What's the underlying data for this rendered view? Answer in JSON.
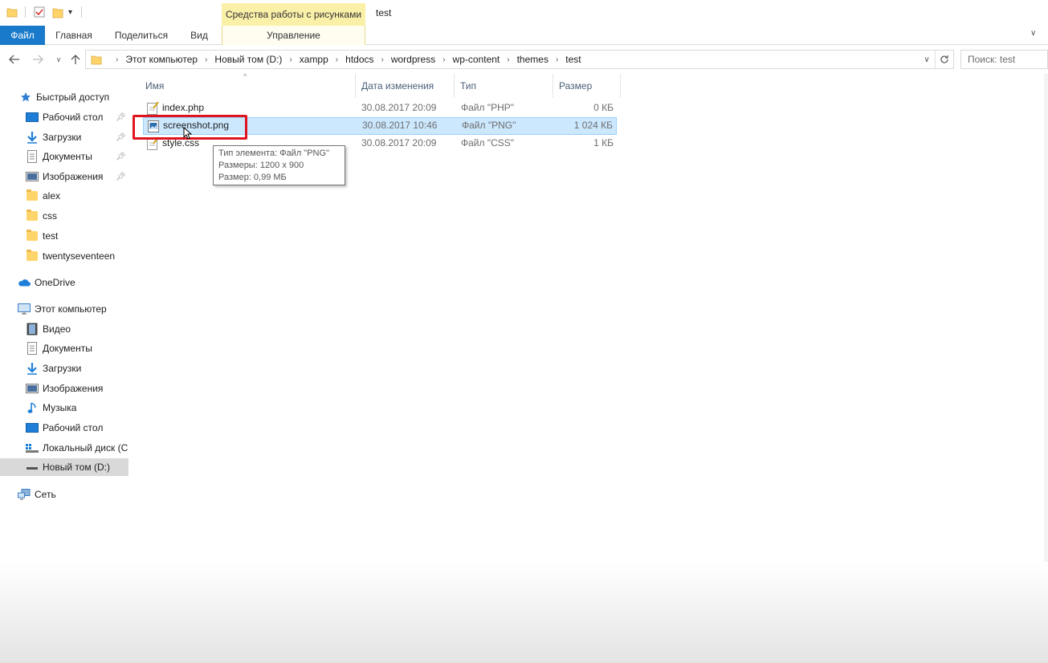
{
  "titlebar": {
    "context_tab": "Средства работы с рисунками",
    "window_title": "test"
  },
  "ribbon": {
    "tabs": [
      "Файл",
      "Главная",
      "Поделиться",
      "Вид"
    ],
    "context_sub": "Управление"
  },
  "address": {
    "crumbs": [
      "Этот компьютер",
      "Новый том (D:)",
      "xampp",
      "htdocs",
      "wordpress",
      "wp-content",
      "themes",
      "test"
    ],
    "search_placeholder": "Поиск: test"
  },
  "nav": {
    "quick_access": "Быстрый доступ",
    "quick_items": [
      "Рабочий стол",
      "Загрузки",
      "Документы",
      "Изображения",
      "alex",
      "css",
      "test",
      "twentyseventeen"
    ],
    "onedrive": "OneDrive",
    "this_pc": "Этот компьютер",
    "pc_items": [
      "Видео",
      "Документы",
      "Загрузки",
      "Изображения",
      "Музыка",
      "Рабочий стол",
      "Локальный диск (C",
      "Новый том (D:)"
    ],
    "network": "Сеть"
  },
  "columns": {
    "name": "Имя",
    "date": "Дата изменения",
    "type": "Тип",
    "size": "Размер"
  },
  "files": [
    {
      "name": "index.php",
      "date": "30.08.2017 20:09",
      "type": "Файл \"PHP\"",
      "size": "0 КБ"
    },
    {
      "name": "screenshot.png",
      "date": "30.08.2017 10:46",
      "type": "Файл \"PNG\"",
      "size": "1 024 КБ"
    },
    {
      "name": "style.css",
      "date": "30.08.2017 20:09",
      "type": "Файл \"CSS\"",
      "size": "1 КБ"
    }
  ],
  "tooltip": {
    "line1": "Тип элемента: Файл \"PNG\"",
    "line2": "Размеры: 1200 x 900",
    "line3": "Размер: 0,99 МБ"
  },
  "colors": {
    "accent": "#1979ca",
    "selection": "#cce8ff",
    "highlight_box": "#e0141e",
    "context_tab": "#fbf0a8"
  }
}
